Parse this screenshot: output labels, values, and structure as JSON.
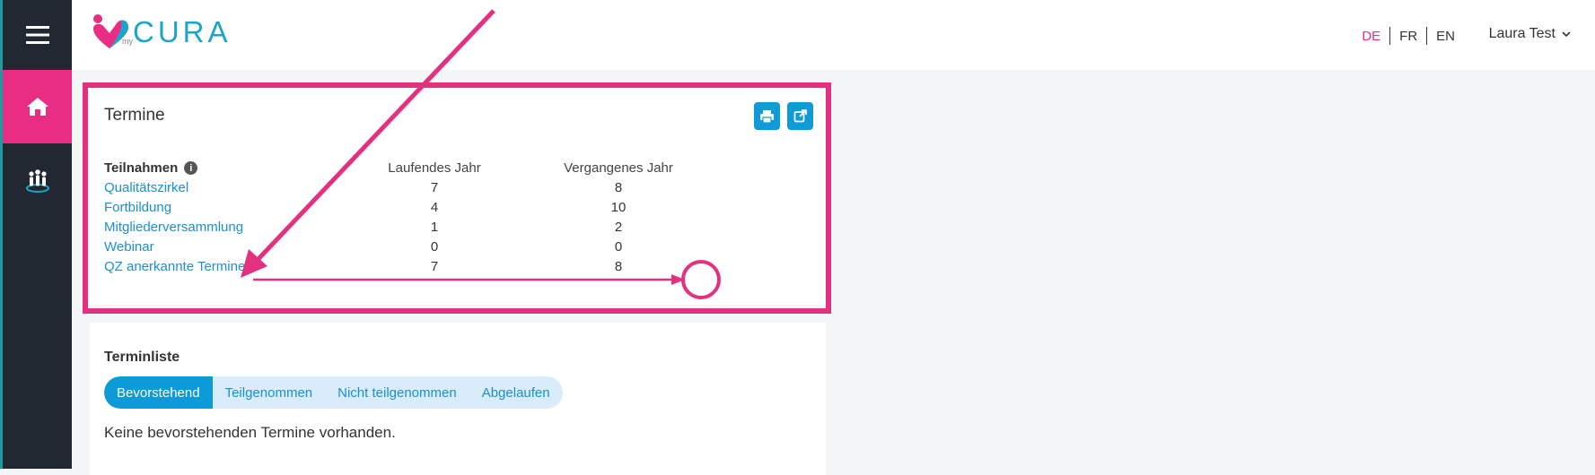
{
  "header": {
    "logo_prefix": "my",
    "logo_text": "CURA",
    "languages": [
      {
        "code": "DE",
        "active": true
      },
      {
        "code": "FR",
        "active": false
      },
      {
        "code": "EN",
        "active": false
      }
    ],
    "user_name": "Laura Test"
  },
  "sidebar": {
    "items": [
      {
        "icon": "hamburger-menu-icon"
      },
      {
        "icon": "home-icon",
        "active": true
      },
      {
        "icon": "community-icon"
      }
    ]
  },
  "termine": {
    "title": "Termine",
    "participation_label": "Teilnahmen",
    "col_current": "Laufendes Jahr",
    "col_previous": "Vergangenes Jahr",
    "rows": [
      {
        "name": "Qualitätszirkel",
        "current": "7",
        "previous": "8"
      },
      {
        "name": "Fortbildung",
        "current": "4",
        "previous": "10"
      },
      {
        "name": "Mitgliederversammlung",
        "current": "1",
        "previous": "2"
      },
      {
        "name": "Webinar",
        "current": "0",
        "previous": "0"
      },
      {
        "name": "QZ anerkannte Termine",
        "current": "7",
        "previous": "8"
      }
    ]
  },
  "terminliste": {
    "title": "Terminliste",
    "tabs": [
      {
        "label": "Bevorstehend",
        "active": true
      },
      {
        "label": "Teilgenommen",
        "active": false
      },
      {
        "label": "Nicht teilgenommen",
        "active": false
      },
      {
        "label": "Abgelaufen",
        "active": false
      }
    ],
    "empty_text": "Keine bevorstehenden Termine vorhanden."
  },
  "colors": {
    "accent_pink": "#e4317f",
    "accent_blue": "#0f9ad8",
    "sidebar_bg": "#222831"
  }
}
